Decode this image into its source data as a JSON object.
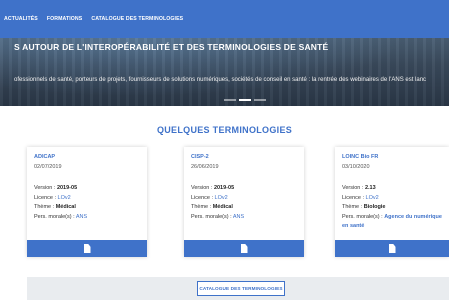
{
  "nav": {
    "items": [
      "ACTUALITÉS",
      "FORMATIONS",
      "CATALOGUE DES TERMINOLOGIES"
    ]
  },
  "hero": {
    "title": "S AUTOUR DE L'INTEROPÉRABILITÉ ET DES TERMINOLOGIES DE SANTÉ",
    "text": "ofessionnels de santé, porteurs de projets, fournisseurs de solutions numériques, sociétés de conseil en santé : la rentrée des webinaires de l'ANS est lanc"
  },
  "section": {
    "title": "QUELQUES TERMINOLOGIES"
  },
  "cards": [
    {
      "name": "ADICAP",
      "date": "02/07/2019",
      "version_label": "Version : ",
      "version": "2019-05",
      "licence_label": "Licence : ",
      "licence": "LOv2",
      "theme_label": "Thème : ",
      "theme": "Médical",
      "org_label": "Pers. morale(s) : ",
      "org": "ANS"
    },
    {
      "name": "CISP-2",
      "date": "26/06/2019",
      "version_label": "Version : ",
      "version": "2019-05",
      "licence_label": "Licence : ",
      "licence": "LOv2",
      "theme_label": "Thème : ",
      "theme": "Médical",
      "org_label": "Pers. morale(s) : ",
      "org": "ANS"
    },
    {
      "name": "LOINC Bio FR",
      "date": "03/10/2020",
      "version_label": "Version : ",
      "version": "2.13",
      "licence_label": "Licence : ",
      "licence": "LOv2",
      "theme_label": "Thème : ",
      "theme": "Biologie",
      "org_label": "Pers. morale(s) : ",
      "org": "Agence du numérique en santé"
    }
  ],
  "catalog_button": {
    "label": "CATALOGUE DES TERMINOLOGIES"
  },
  "icons": {
    "card_footer": "document-icon"
  },
  "colors": {
    "primary": "#3f72c9",
    "catalog_bg": "#e9ecef"
  }
}
